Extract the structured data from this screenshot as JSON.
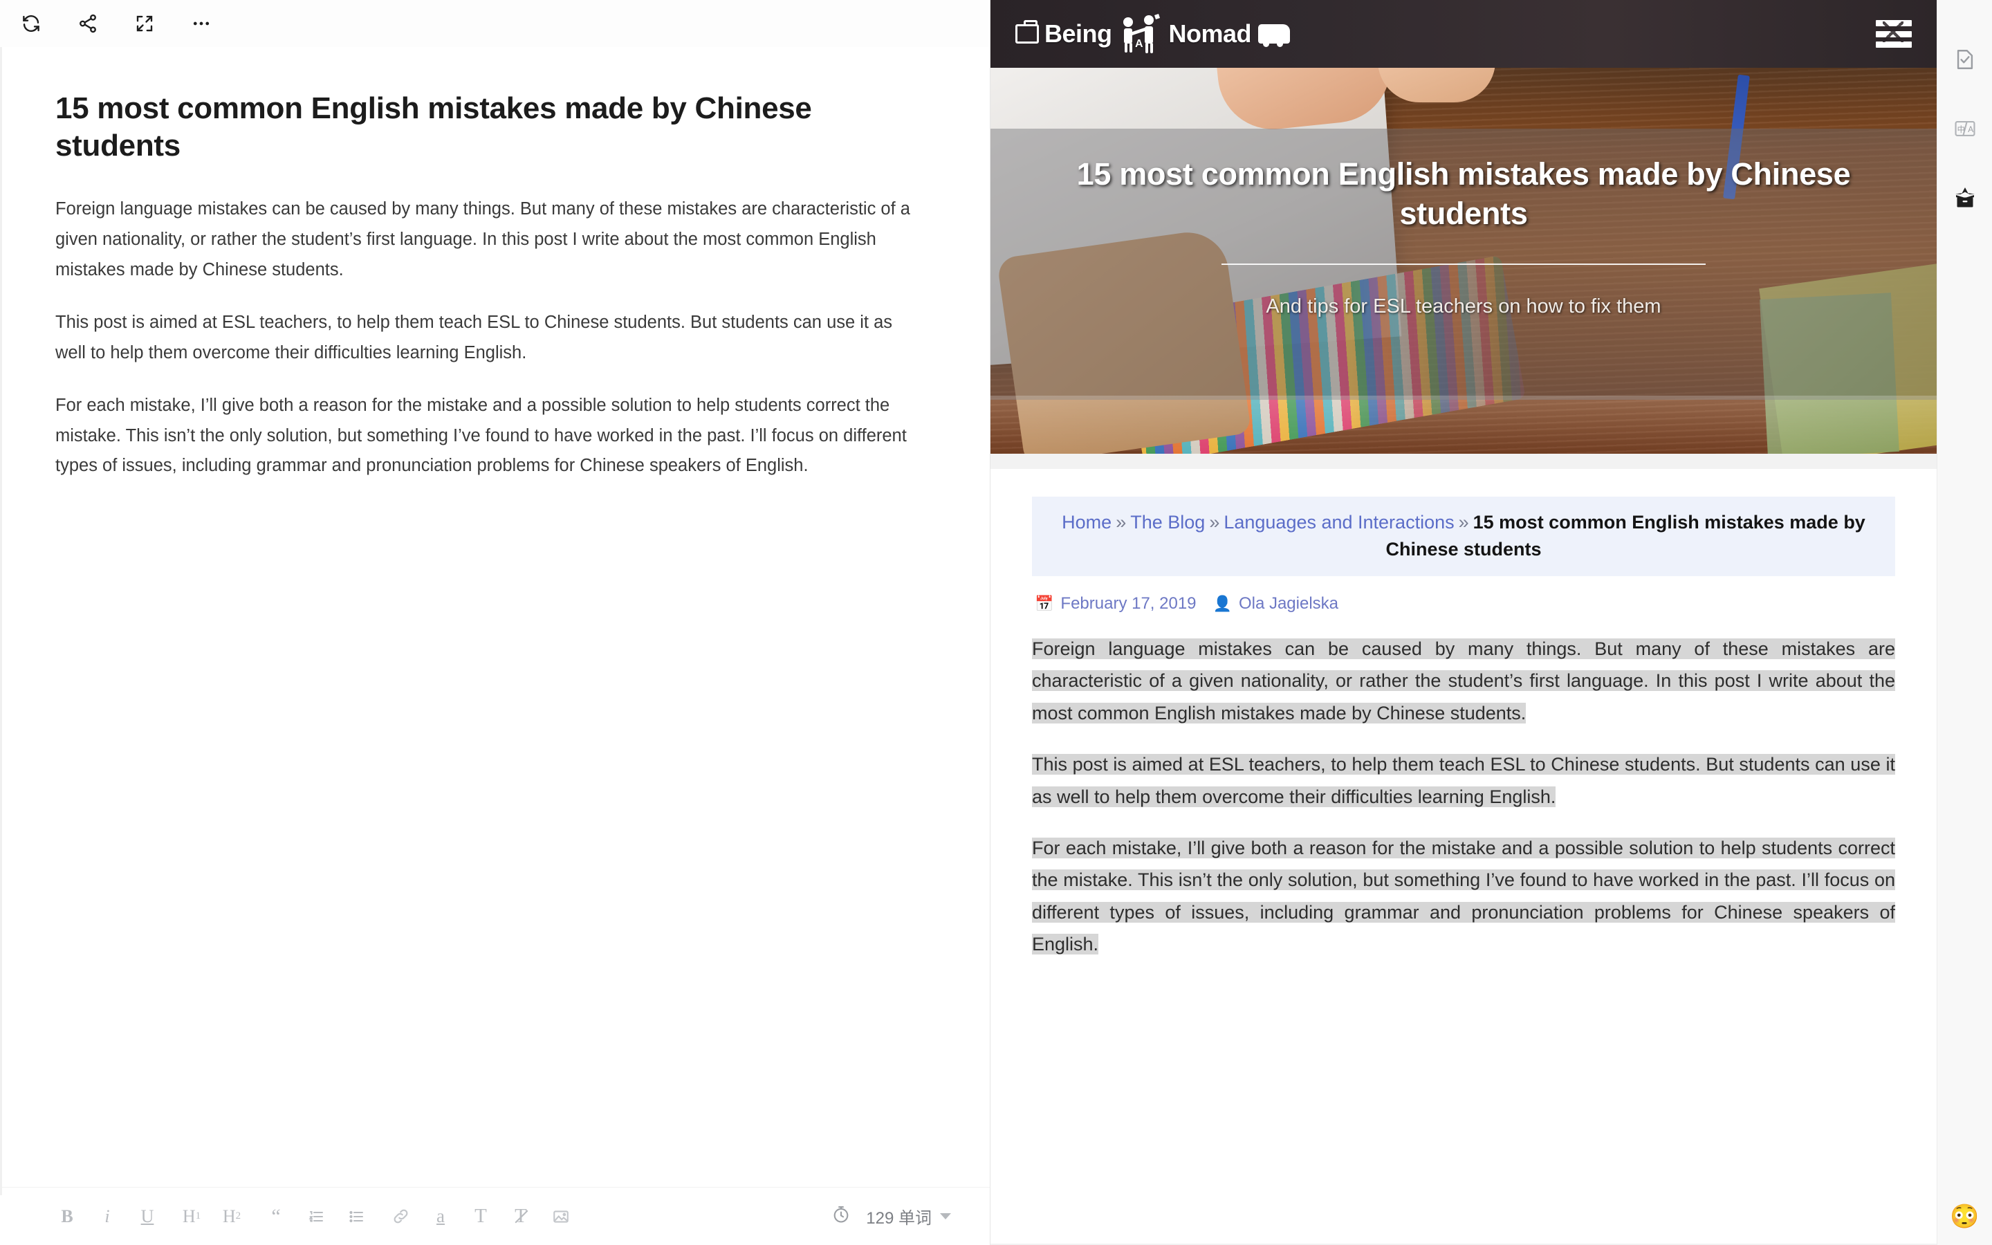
{
  "editor": {
    "toolbar": [
      {
        "name": "refresh-icon",
        "label": "Refresh"
      },
      {
        "name": "share-icon",
        "label": "Share"
      },
      {
        "name": "fullscreen-icon",
        "label": "Fullscreen"
      },
      {
        "name": "more-options-icon",
        "label": "More"
      }
    ],
    "title": "15 most common English mistakes made by Chinese students",
    "paragraphs": [
      "Foreign language mistakes can be caused by many things. But many of these mistakes are characteristic of a given nationality, or rather the student’s first language. In this post I write about the most common English mistakes made by Chinese students.",
      "This post is aimed at ESL teachers, to help them teach ESL to Chinese students. But students can use it as well to help them overcome their difficulties learning English.",
      "For each mistake, I’ll give both a reason for the mistake and a possible solution to help students correct the mistake. This isn’t the only solution, but something I’ve found to have worked in the past. I’ll focus on different types of issues, including grammar and pronunciation problems for Chinese speakers of English."
    ],
    "format_buttons": [
      {
        "name": "bold-button",
        "label": "B"
      },
      {
        "name": "italic-button",
        "label": "i"
      },
      {
        "name": "underline-button",
        "label": "U"
      },
      {
        "name": "heading-1-button",
        "label": "H1"
      },
      {
        "name": "heading-2-button",
        "label": "H2"
      },
      {
        "name": "blockquote-button",
        "label": "“"
      },
      {
        "name": "ordered-list-button",
        "label": "ordered-list"
      },
      {
        "name": "unordered-list-button",
        "label": "bullet-list"
      },
      {
        "name": "link-button",
        "label": "link"
      },
      {
        "name": "highlight-button",
        "label": "a"
      },
      {
        "name": "text-color-button",
        "label": "T"
      },
      {
        "name": "clear-formatting-button",
        "label": "clear"
      },
      {
        "name": "insert-image-button",
        "label": "image"
      }
    ],
    "word_count": "129 单词"
  },
  "preview": {
    "site_logo": "Being A Nomad",
    "site_logo_parts": {
      "first": "Being",
      "middle": "A",
      "last": "Nomad"
    },
    "menu_label": "Menu",
    "hero": {
      "title": "15 most common English mistakes made by Chinese students",
      "subtitle": "And tips for ESL teachers on how to fix them"
    },
    "breadcrumb": {
      "items": [
        {
          "label": "Home",
          "link": true
        },
        {
          "label": "The Blog",
          "link": true
        },
        {
          "label": "Languages and Interactions",
          "link": true
        }
      ],
      "separator": "»",
      "current": "15 most common English mistakes made by Chinese students"
    },
    "meta": {
      "date": "February 17, 2019",
      "author": "Ola Jagielska",
      "date_icon": "calendar-icon",
      "author_icon": "user-icon"
    },
    "paragraphs": [
      "Foreign language mistakes can be caused by many things. But many of these mistakes are characteristic of a given nationality, or rather the student’s first language. In this post I write about the most common English mistakes made by Chinese students.",
      "This post is aimed at ESL teachers, to help them teach ESL to Chinese students. But students can use it as well to help them overcome their difficulties learning English.",
      "For each mistake, I’ll give both a reason for the mistake and a possible solution to help students correct the mistake. This isn’t the only solution, but something I’ve found to have worked in the past. I’ll focus on different types of issues, including grammar and pronunciation problems for Chinese speakers of English."
    ]
  },
  "rail": {
    "items": [
      {
        "name": "document-check-icon",
        "label": "Proofread"
      },
      {
        "name": "translate-icon",
        "label": "中/A"
      },
      {
        "name": "surprise-box-icon",
        "label": "Box"
      }
    ],
    "emoji": "😳"
  },
  "colors": {
    "link": "#5b6dc8",
    "breadcrumb_bg": "#eef2fb",
    "selection": "#d6d6d6",
    "header_bg": "#2d2629"
  }
}
